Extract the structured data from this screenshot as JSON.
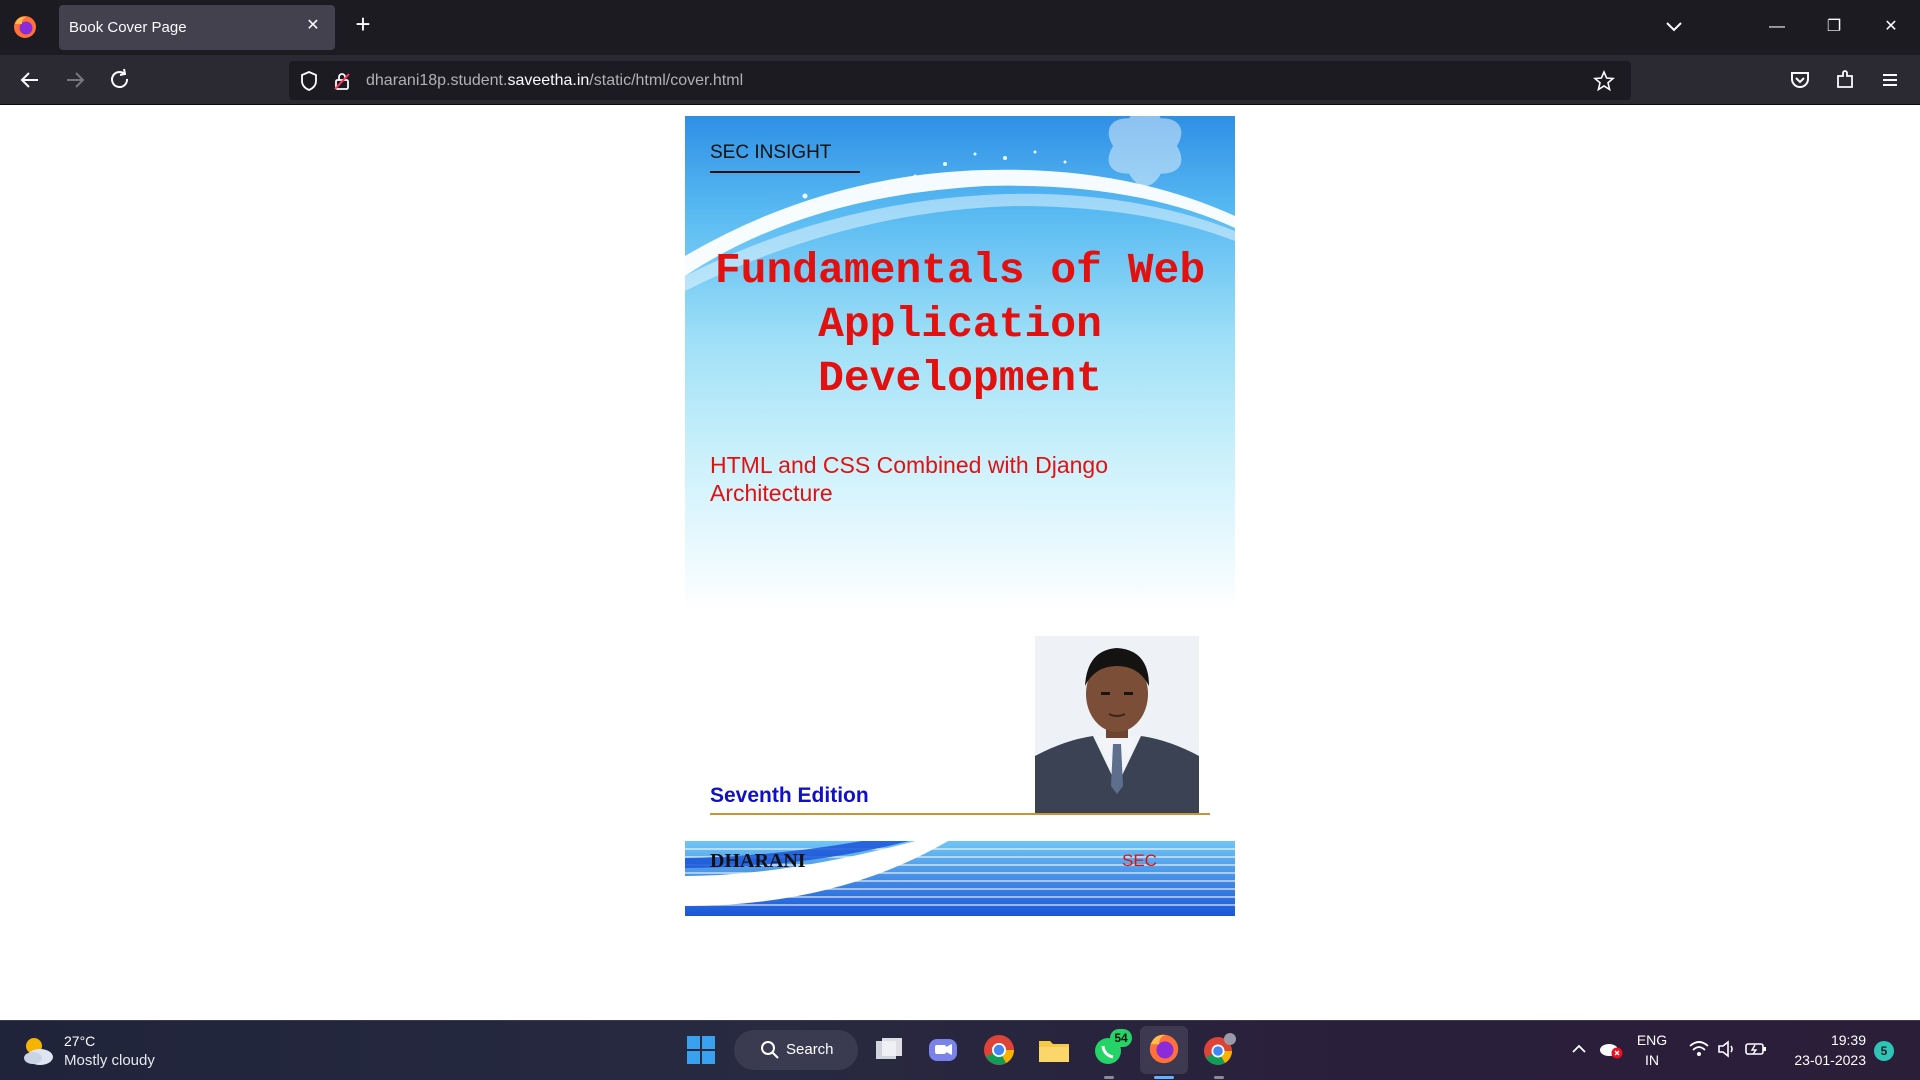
{
  "browser": {
    "tab_title": "Book Cover Page",
    "url_prefix": "dharani18p.student.",
    "url_domain": "saveetha.in",
    "url_path": "/static/html/cover.html"
  },
  "cover": {
    "publisher": "SEC INSIGHT",
    "title": "Fundamentals of Web Application Development",
    "subtitle": "HTML and CSS Combined with Django Architecture",
    "edition": "Seventh Edition",
    "author": "DHARANI",
    "org": "SEC"
  },
  "taskbar": {
    "weather_temp": "27°C",
    "weather_desc": "Mostly cloudy",
    "search_label": "Search",
    "whatsapp_badge": "54",
    "lang_line1": "ENG",
    "lang_line2": "IN",
    "time": "19:39",
    "date": "23-01-2023",
    "notification_count": "5"
  },
  "colors": {
    "title_red": "#e31010",
    "edition_blue": "#1010c8",
    "browser_dark": "#1c1b22"
  }
}
